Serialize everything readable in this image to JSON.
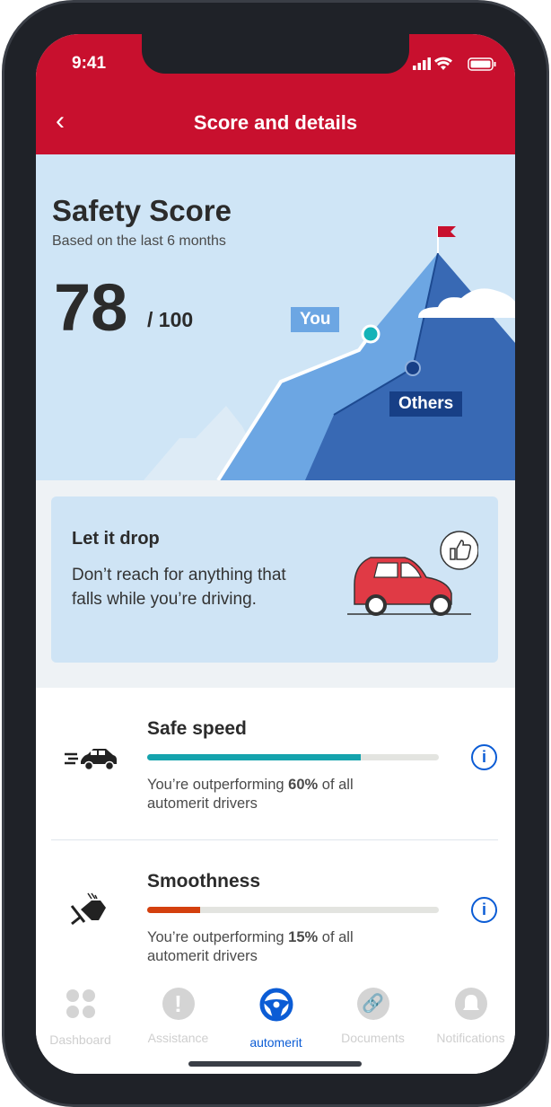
{
  "status_bar": {
    "time": "9:41"
  },
  "header": {
    "title": "Score and details",
    "back_icon": "chevron-left-icon"
  },
  "score": {
    "title": "Safety Score",
    "subtitle": "Based on the last 6 months",
    "value": "78",
    "max": "/ 100",
    "you_label": "You",
    "others_label": "Others"
  },
  "tip": {
    "title": "Let it drop",
    "body": "Don’t reach for anything that falls while you’re driving."
  },
  "metrics": [
    {
      "title": "Safe speed",
      "percent": 60,
      "prefix": "You’re outperforming ",
      "value": "60%",
      "suffix": " of all automerit drivers",
      "color": "#14a3ad",
      "icon": "speeding-car-icon"
    },
    {
      "title": "Smoothness",
      "percent": 15,
      "prefix": "You’re outperforming ",
      "value": "15%",
      "suffix": " of all automerit drivers",
      "color": "#d4400e",
      "icon": "brake-pedal-icon"
    }
  ],
  "tabs": [
    {
      "label": "Dashboard",
      "active": false
    },
    {
      "label": "Assistance",
      "active": false
    },
    {
      "label": "automerit",
      "active": true
    },
    {
      "label": "Documents",
      "active": false
    },
    {
      "label": "Notifications",
      "active": false
    }
  ],
  "colors": {
    "brand": "#c8102e",
    "accent": "#0b5cd5"
  }
}
